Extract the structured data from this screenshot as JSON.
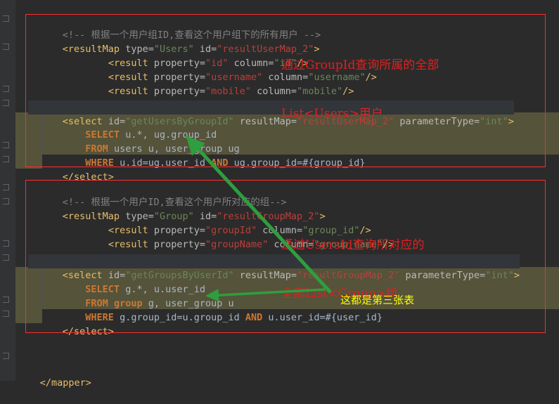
{
  "editor": {
    "background": "#2b2b2b",
    "gutter_background": "#313335",
    "sql_block_background": "#55533a",
    "default_text_color": "#a9b7c6"
  },
  "code": {
    "block1": {
      "comment": "<!-- 根据一个用户组ID,查看这个用户组下的所有用户 -->",
      "resultmap_open_tag": "<resultMap",
      "resultmap_type_attr": " type=",
      "resultmap_type_value": "\"Users\"",
      "resultmap_id_attr": " id=",
      "resultmap_id_value": "\"resultUserMap_2\"",
      "resultmap_close_bracket": ">",
      "result1": "        <result property=\"id\" column=\"id\"/>",
      "result1_prop": "\"id\"",
      "result1_col": "\"id\"",
      "result2_prop": "\"username\"",
      "result2_col": "\"username\"",
      "result3_prop": "\"mobile\"",
      "result3_col": "\"mobile\"",
      "resultmap_close": "</resultMap>",
      "select_open_tag": "<select",
      "select_id_attr": " id=",
      "select_id_value": "\"getUsersByGroupId\"",
      "select_resultmap_attr": " resultMap=",
      "select_resultmap_value": "\"resultUserMap_2\"",
      "select_paramtype_attr": " parameterType=",
      "select_paramtype_value": "\"int\"",
      "sql_select_kw": "SELECT",
      "sql_select_rest": " u.*, ug.group_id",
      "sql_from_kw": "FROM",
      "sql_from_rest": " users u, user_group ug",
      "sql_where_kw": "WHERE",
      "sql_where_a": " u.id=ug.user_id ",
      "sql_and_kw": "AND",
      "sql_where_b": " ug.group_id=#{group_id}",
      "select_close": "</select>"
    },
    "block2": {
      "comment": "<!-- 根据一个用户ID,查看这个用户所对应的组-->",
      "resultmap_open_tag": "<resultMap",
      "resultmap_type_attr": " type=",
      "resultmap_type_value": "\"Group\"",
      "resultmap_id_attr": " id=",
      "resultmap_id_value": "\"resultGroupMap_2\"",
      "result1_prop": "\"groupId\"",
      "result1_col": "\"group_id\"",
      "result2_prop": "\"groupName\"",
      "result2_col": "\"group_name\"",
      "resultmap_close": "</resultMap>",
      "select_open_tag": "<select",
      "select_id_attr": " id=",
      "select_id_value": "\"getGroupsByUserId\"",
      "select_resultmap_attr": " resultMap=",
      "select_resultmap_value": "\"resultGroupMap_2\"",
      "select_paramtype_attr": " parameterType=",
      "select_paramtype_value": "\"int\"",
      "sql_select_kw": "SELECT",
      "sql_select_rest": " g.*, u.user_id",
      "sql_from_kw": "FROM",
      "sql_from_group_kw": "group",
      "sql_from_rest": " g, user_group u",
      "sql_where_kw": "WHERE",
      "sql_where_a": " g.group_id=u.group_id ",
      "sql_and_kw": "AND",
      "sql_where_b": " u.user_id=#{user_id}",
      "select_close": "</select>"
    },
    "mapper_close": "</mapper>",
    "common": {
      "result_tag": "<result",
      "property_attr": " property=",
      "column_attr": " column=",
      "selfclose": "/>",
      "gt": ">",
      "indent4": "    ",
      "indent8": "        "
    }
  },
  "annotations": {
    "red_note_1_line1": "通过GroupId查询所属的全部",
    "red_note_1_line2": "List<Users>用户",
    "red_note_2_line1": "通过UsersId查询所对应的",
    "red_note_2_line2": "全部List<Group>组",
    "yellow_note": "这都是第三张表",
    "red_color": "#e02020",
    "yellow_color": "#ffff00",
    "arrow_color": "#2e9e3e"
  }
}
